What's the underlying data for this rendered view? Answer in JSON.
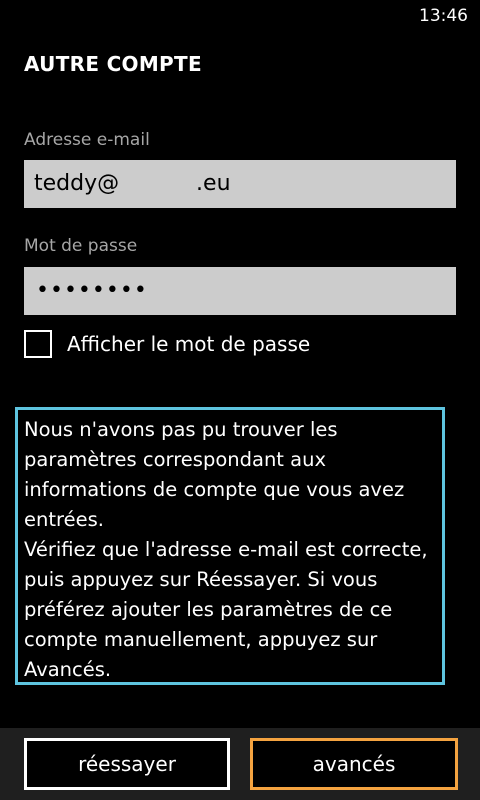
{
  "status_bar": {
    "time": "13:46"
  },
  "page": {
    "title": "AUTRE COMPTE"
  },
  "form": {
    "email_label": "Adresse e-mail",
    "email_value": "teddy@           .eu",
    "password_label": "Mot de passe",
    "password_value": "••••••••",
    "show_password_label": "Afficher le mot de passe",
    "show_password_checked": false
  },
  "message": {
    "paragraph1": "Nous n'avons pas pu trouver les paramètres correspondant aux informations de compte que vous avez entrées.",
    "paragraph2": "Vérifiez que l'adresse e-mail est correcte, puis appuyez sur Réessayer. Si vous préférez ajouter les paramètres de ce compte manuellement, appuyez sur Avancés."
  },
  "app_bar": {
    "retry_label": "réessayer",
    "advanced_label": "avancés"
  },
  "colors": {
    "background": "#000000",
    "field_background": "#cccccc",
    "message_border": "#5ec4df",
    "accent_button_border": "#f4a340",
    "app_bar_background": "#1f1f1f",
    "label_gray": "#a6a6a6"
  }
}
